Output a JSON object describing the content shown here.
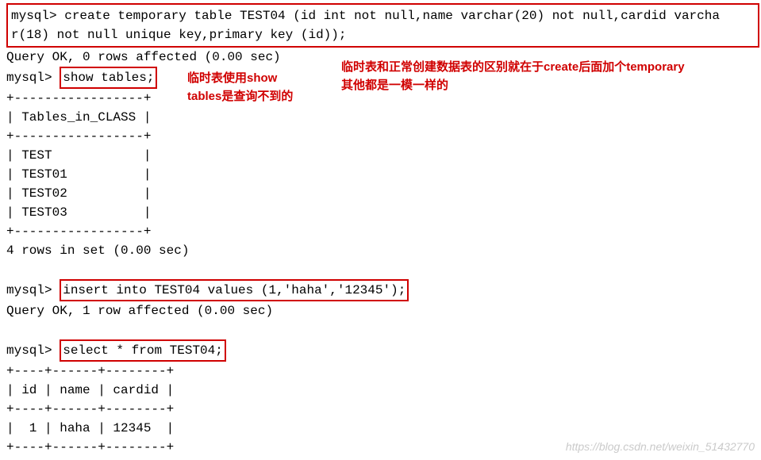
{
  "sql": {
    "line1": "mysql> create temporary table TEST04 (id int not null,name varchar(20) not null,cardid varcha",
    "line2": "r(18) not null unique key,primary key (id));",
    "result1": "Query OK, 0 rows affected (0.00 sec)",
    "prompt_show": "mysql> ",
    "show_tables": "show tables;",
    "table_border": "+-----------------+",
    "table_header": "| Tables_in_CLASS |",
    "table_row1": "| TEST            |",
    "table_row2": "| TEST01          |",
    "table_row3": "| TEST02          |",
    "table_row4": "| TEST03          |",
    "table_footer": "4 rows in set (0.00 sec)",
    "prompt_insert": "mysql> ",
    "insert_stmt": "insert into TEST04 values (1,'haha','12345');",
    "result2": "Query OK, 1 row affected (0.00 sec)",
    "prompt_select": "mysql> ",
    "select_stmt": "select * from TEST04;",
    "result_border": "+----+------+--------+",
    "result_header": "| id | name | cardid |",
    "result_row": "|  1 | haha | 12345  |"
  },
  "annotations": {
    "a1_line1": "临时表使用show",
    "a1_line2": "tables是查询不到的",
    "a2_line1": "临时表和正常创建数据表的区别就在于create后面加个temporary",
    "a2_line2": "其他都是一模一样的"
  },
  "watermark": "https://blog.csdn.net/weixin_51432770"
}
